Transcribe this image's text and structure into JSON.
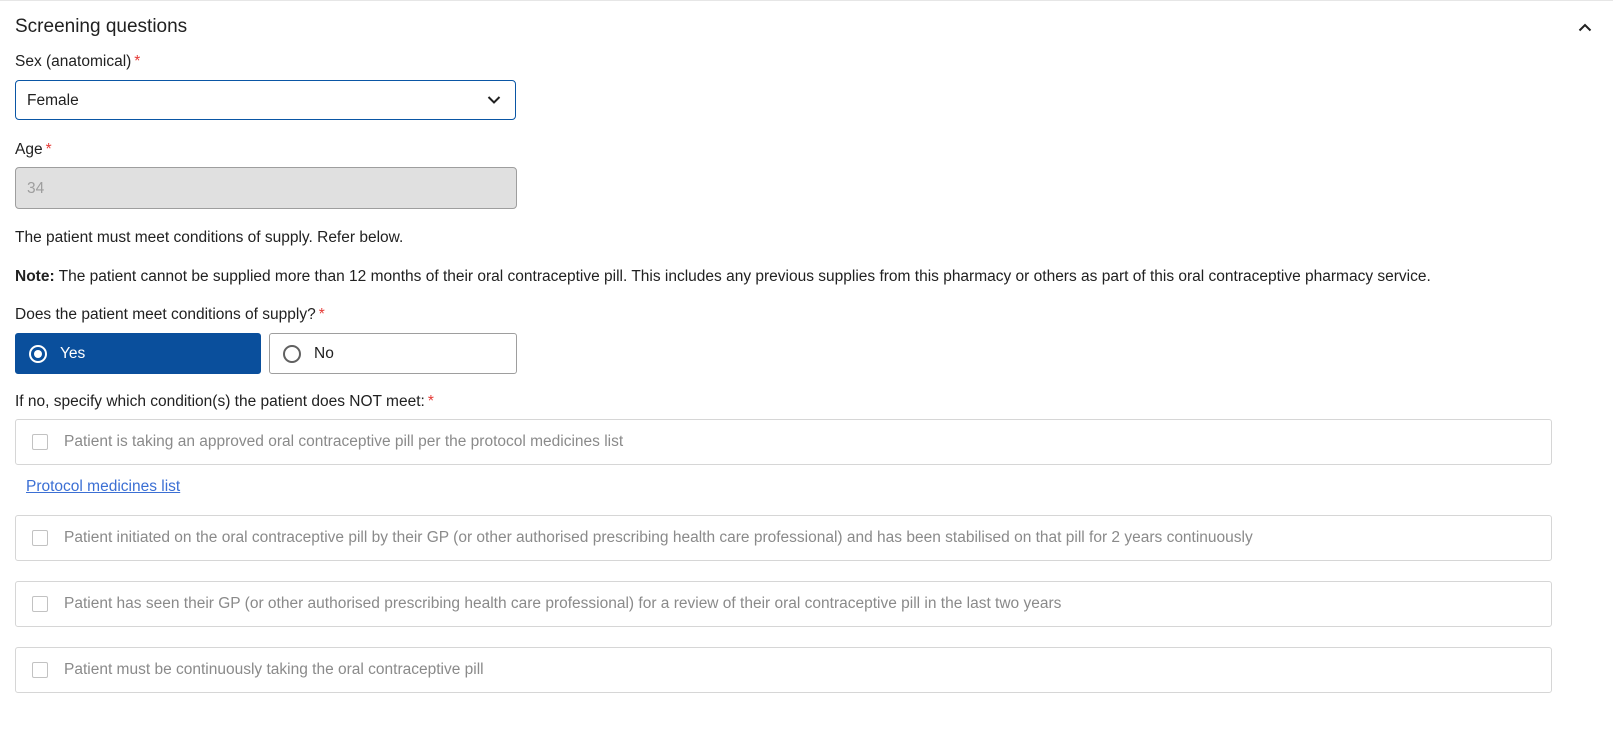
{
  "section": {
    "title": "Screening questions"
  },
  "sex": {
    "label": "Sex (anatomical)",
    "required_mark": "*",
    "value": "Female"
  },
  "age": {
    "label": "Age",
    "required_mark": "*",
    "value": "34"
  },
  "info": {
    "conditions_text": "The patient must meet conditions of supply. Refer below.",
    "note_label": "Note:",
    "note_text": " The patient cannot be supplied more than 12 months of their oral contraceptive pill. This includes any previous supplies from this pharmacy or others as part of this oral contraceptive pharmacy service."
  },
  "meet_conditions": {
    "label": "Does the patient meet conditions of supply?",
    "required_mark": "*",
    "options": [
      {
        "label": "Yes",
        "selected": true
      },
      {
        "label": "No",
        "selected": false
      }
    ]
  },
  "not_met": {
    "label": "If no, specify which condition(s) the patient does NOT meet:",
    "required_mark": "*",
    "items": [
      {
        "label": "Patient is taking an approved oral contraceptive pill per the protocol medicines list",
        "checked": false
      },
      {
        "label": "Patient initiated on the oral contraceptive pill by their GP (or other authorised prescribing health care professional) and has been stabilised on that pill for 2 years continuously",
        "checked": false
      },
      {
        "label": "Patient has seen their GP (or other authorised prescribing health care professional) for a review of their oral contraceptive pill in the last two years",
        "checked": false
      },
      {
        "label": "Patient must be continuously taking the oral contraceptive pill",
        "checked": false
      }
    ],
    "link_label": "Protocol medicines list"
  },
  "colors": {
    "primary": "#0a4f9c",
    "focus_border": "#0a56a5",
    "required": "#e53935",
    "link": "#3b6fd4",
    "disabled_bg": "#e0e0e0",
    "disabled_text": "#8a8a8a"
  },
  "icons": {
    "collapse": "chevron-up-icon",
    "dropdown": "chevron-down-icon"
  }
}
